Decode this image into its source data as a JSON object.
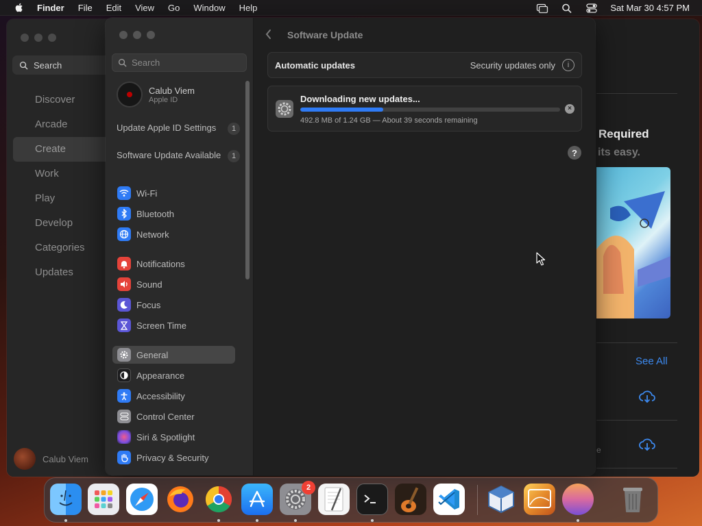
{
  "menubar": {
    "app": "Finder",
    "items": [
      "File",
      "Edit",
      "View",
      "Go",
      "Window",
      "Help"
    ],
    "clock": "Sat Mar 30  4:57 PM",
    "icons": [
      "apple-icon",
      "screen-mirroring-icon",
      "spotlight-search-icon",
      "control-center-icon"
    ]
  },
  "appstore": {
    "search_label": "Search",
    "nav": [
      "Discover",
      "Arcade",
      "Create",
      "Work",
      "Play",
      "Develop",
      "Categories",
      "Updates"
    ],
    "selected": "Create",
    "user": "Calub Viem",
    "heading": "Required",
    "subheading": "its easy.",
    "see_all": "See All",
    "partial_text": "e"
  },
  "settings": {
    "search_placeholder": "Search",
    "account": {
      "name": "Calub Viem",
      "subtitle": "Apple ID"
    },
    "notices": [
      {
        "text": "Update Apple ID Settings",
        "count": "1"
      },
      {
        "text": "Software Update Available",
        "count": "1"
      }
    ],
    "sidebar_groups": [
      [
        {
          "label": "Wi-Fi",
          "icon": "wifi-icon",
          "color": "#2f7bf5"
        },
        {
          "label": "Bluetooth",
          "icon": "bluetooth-icon",
          "color": "#2f7bf5"
        },
        {
          "label": "Network",
          "icon": "network-icon",
          "color": "#2f7bf5"
        }
      ],
      [
        {
          "label": "Notifications",
          "icon": "bell-icon",
          "color": "#e5433a"
        },
        {
          "label": "Sound",
          "icon": "speaker-icon",
          "color": "#e5433a"
        },
        {
          "label": "Focus",
          "icon": "moon-icon",
          "color": "#5b56d6"
        },
        {
          "label": "Screen Time",
          "icon": "hourglass-icon",
          "color": "#5b56d6"
        }
      ],
      [
        {
          "label": "General",
          "icon": "gear-icon",
          "color": "#8e8e93",
          "selected": true
        },
        {
          "label": "Appearance",
          "icon": "appearance-icon",
          "color": "#1c1c1e"
        },
        {
          "label": "Accessibility",
          "icon": "accessibility-icon",
          "color": "#2f7bf5"
        },
        {
          "label": "Control Center",
          "icon": "control-center-icon",
          "color": "#8e8e93"
        },
        {
          "label": "Siri & Spotlight",
          "icon": "siri-icon",
          "color": "#c94bd1"
        },
        {
          "label": "Privacy & Security",
          "icon": "hand-icon",
          "color": "#2f7bf5"
        }
      ]
    ],
    "main": {
      "title": "Software Update",
      "auto_label": "Automatic updates",
      "auto_value": "Security updates only",
      "download": {
        "heading": "Downloading new updates...",
        "progress": 0.32,
        "status": "492.8 MB of 1.24 GB — About 39 seconds remaining"
      }
    }
  },
  "dock": {
    "apps": [
      {
        "name": "finder",
        "color": "#2b8ef0",
        "running": true
      },
      {
        "name": "launchpad",
        "color": "#e9e9ee",
        "running": false
      },
      {
        "name": "safari",
        "color": "#2f9af5",
        "running": false
      },
      {
        "name": "firefox",
        "color": "#ff7a1a",
        "running": false
      },
      {
        "name": "chrome",
        "color": "#f4f4f4",
        "running": true
      },
      {
        "name": "app-store",
        "color": "#1e8ef5",
        "running": true
      },
      {
        "name": "system-settings",
        "color": "#8e8e93",
        "running": true,
        "badge": "2"
      },
      {
        "name": "textedit",
        "color": "#f2f2f2",
        "running": false
      },
      {
        "name": "terminal",
        "color": "#1a1a1a",
        "running": true
      },
      {
        "name": "garageband",
        "color": "#3a2a1e",
        "running": false
      },
      {
        "name": "vscode",
        "color": "#1f8ad2",
        "running": false
      },
      {
        "name": "virtualbox",
        "color": "#3a6aa8",
        "running": false
      },
      {
        "name": "macos-installer",
        "color": "#e58a2b",
        "running": false
      },
      {
        "name": "macos-sequoia-wallpaper",
        "color": "#d96aa0",
        "running": true
      },
      {
        "name": "trash",
        "color": "#8a8a8a",
        "running": false
      }
    ]
  }
}
